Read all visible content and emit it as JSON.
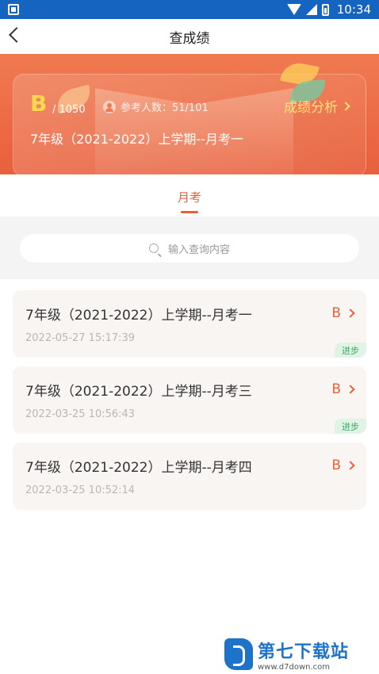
{
  "status_bar": {
    "time": "10:34"
  },
  "nav": {
    "title": "查成绩"
  },
  "summary": {
    "grade": "B",
    "total": "/ 1050",
    "participants_label": "参考人数：51/101",
    "analysis_label": "成绩分析",
    "exam_title": "7年级（2021-2022）上学期--月考一"
  },
  "tabs": [
    {
      "label": "月考",
      "active": true
    }
  ],
  "search": {
    "placeholder": "输入查询内容"
  },
  "exams": [
    {
      "title": "7年级（2021-2022）上学期--月考一",
      "date": "2022-05-27 15:17:39",
      "grade": "B",
      "badge": "进步"
    },
    {
      "title": "7年级（2021-2022）上学期--月考三",
      "date": "2022-03-25 10:56:43",
      "grade": "B",
      "badge": "进步"
    },
    {
      "title": "7年级（2021-2022）上学期--月考四",
      "date": "2022-03-25 10:52:14",
      "grade": "B",
      "badge": ""
    }
  ],
  "watermark": {
    "name": "第七下载站",
    "url": "www.d7down.com"
  },
  "colors": {
    "accent": "#e8603c",
    "grade_highlight": "#ffd94d",
    "badge_green": "#3aa663",
    "status_bar": "#1565c0"
  }
}
